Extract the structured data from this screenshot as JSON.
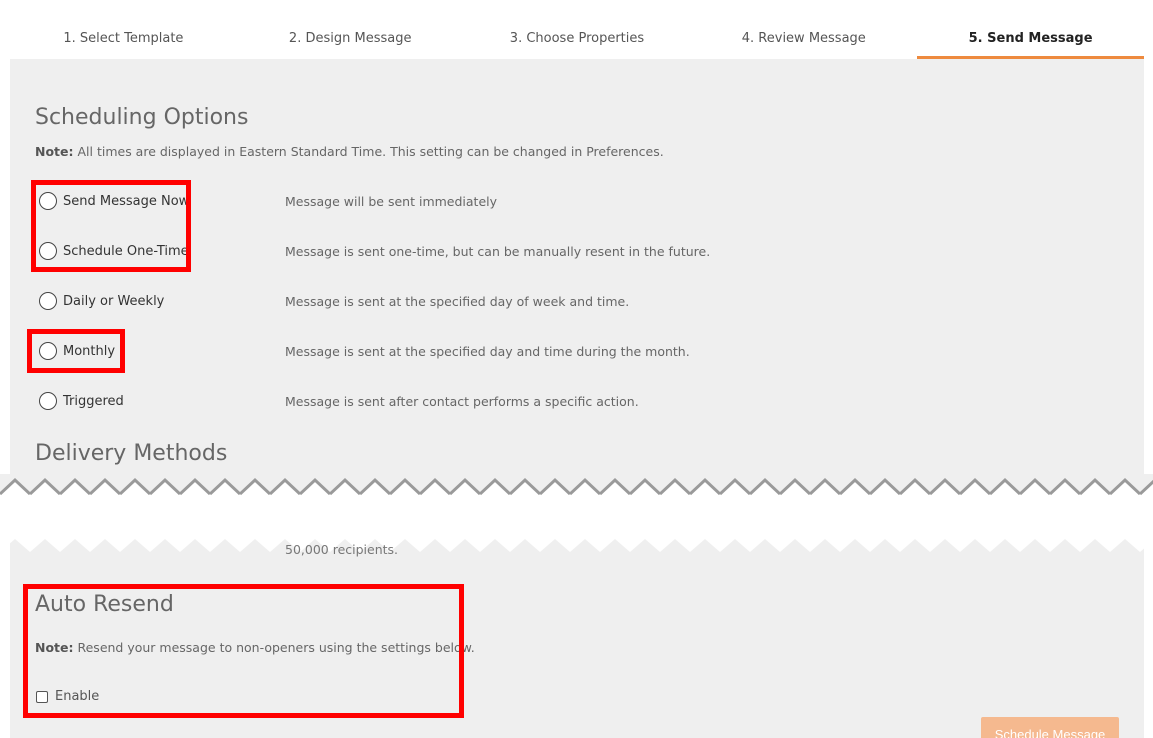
{
  "tabs": [
    {
      "label": "1. Select Template"
    },
    {
      "label": "2. Design Message"
    },
    {
      "label": "3. Choose Properties"
    },
    {
      "label": "4. Review Message"
    },
    {
      "label": "5. Send Message",
      "active": true
    }
  ],
  "scheduling": {
    "title": "Scheduling Options",
    "note_prefix": "Note:",
    "note_text": " All times are displayed in Eastern Standard Time. This setting can be changed in Preferences.",
    "options": [
      {
        "label": "Send Message Now",
        "description": "Message will be sent immediately"
      },
      {
        "label": "Schedule One-Time",
        "description": "Message is sent one-time, but can be manually resent in the future."
      },
      {
        "label": "Daily or Weekly",
        "description": "Message is sent at the specified day of week and time."
      },
      {
        "label": "Monthly",
        "description": "Message is sent at the specified day and time during the month."
      },
      {
        "label": "Triggered",
        "description": "Message is sent after contact performs a specific action."
      }
    ]
  },
  "delivery": {
    "title": "Delivery Methods",
    "partial_text": "50,000 recipients."
  },
  "auto_resend": {
    "title": "Auto Resend",
    "note_prefix": "Note:",
    "note_text": " Resend your message to non-openers using the settings below.",
    "enable_label": "Enable"
  },
  "actions": {
    "schedule_label": "Schedule Message"
  },
  "colors": {
    "accent": "#ee8a3e",
    "highlight": "#ff0000",
    "panel_bg": "#efefef",
    "button_bg": "#f5b98f"
  }
}
